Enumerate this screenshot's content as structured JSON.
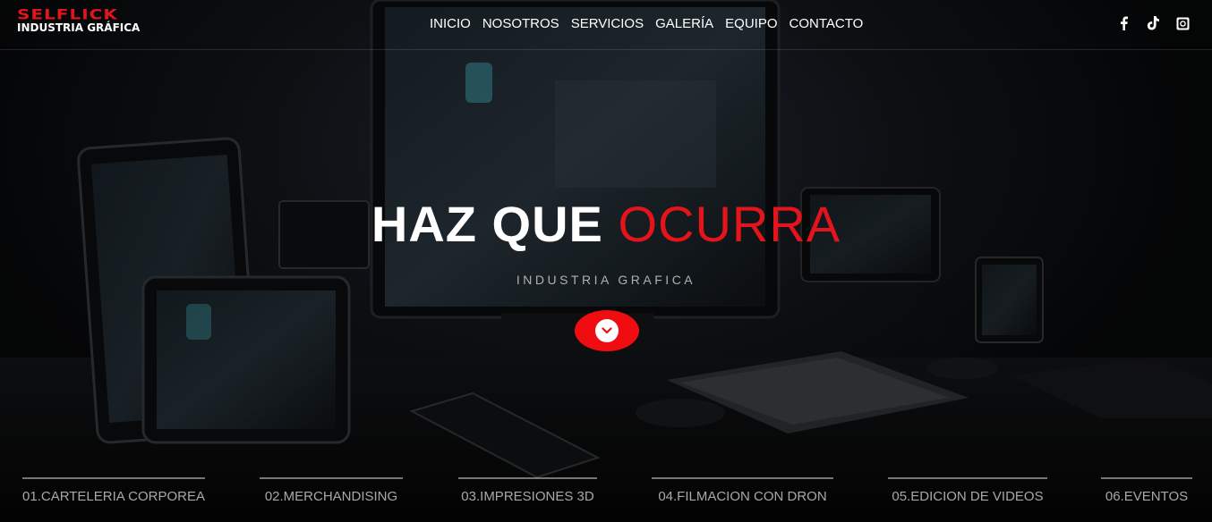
{
  "brand": {
    "name": "SELFLICK",
    "tagline": "INDUSTRIA GRÁFICA",
    "accent_color": "#e3141b"
  },
  "nav": {
    "items": [
      {
        "label": "INICIO"
      },
      {
        "label": "NOSOTROS"
      },
      {
        "label": "SERVICIOS"
      },
      {
        "label": "GALERÍA"
      },
      {
        "label": "EQUIPO"
      },
      {
        "label": "CONTACTO"
      }
    ]
  },
  "social": {
    "icons": [
      "facebook-icon",
      "tiktok-icon",
      "instagram-icon"
    ]
  },
  "hero": {
    "title_part1": "HAZ QUE",
    "title_part2": "OCURRA",
    "subtitle": "INDUSTRIA GRAFICA",
    "scroll_icon": "chevron-down-icon"
  },
  "services": [
    {
      "label": "01.CARTELERIA CORPOREA"
    },
    {
      "label": "02.MERCHANDISING"
    },
    {
      "label": "03.IMPRESIONES 3D"
    },
    {
      "label": "04.FILMACION CON DRON"
    },
    {
      "label": "05.EDICION DE VIDEOS"
    },
    {
      "label": "06.EVENTOS"
    }
  ]
}
